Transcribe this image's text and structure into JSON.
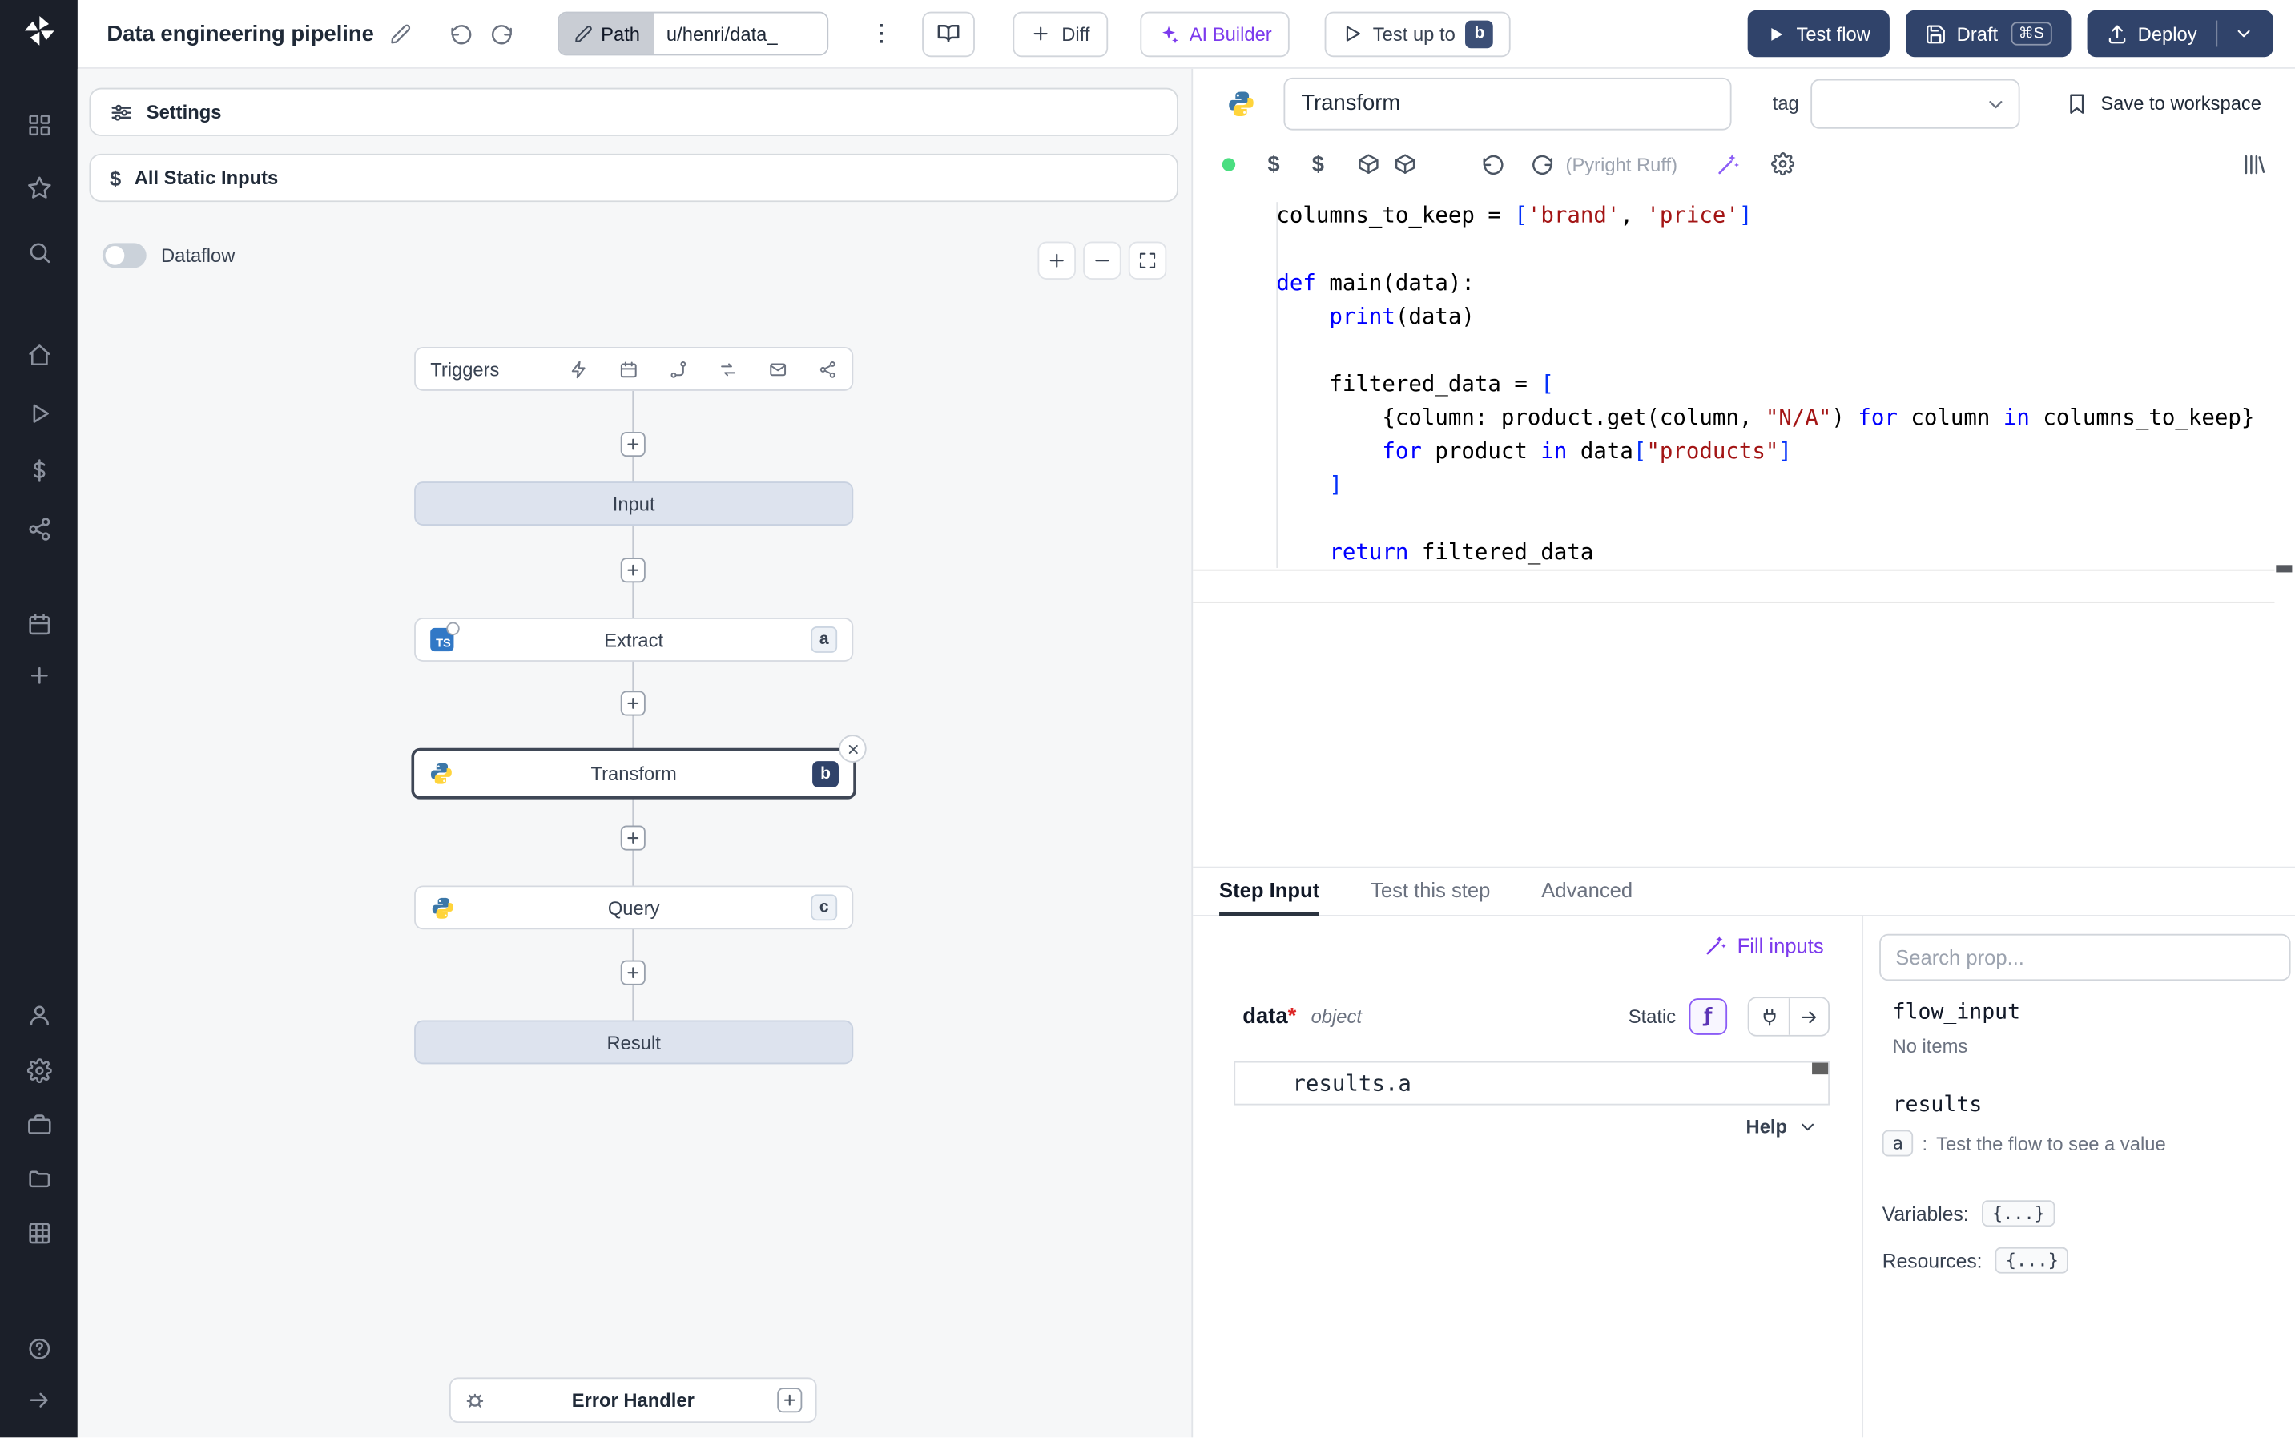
{
  "toolbar": {
    "title": "Data engineering pipeline",
    "path_button": "Path",
    "path_value": "u/henri/data_",
    "diff": "Diff",
    "ai_builder": "AI Builder",
    "test_up_to": "Test up to",
    "test_up_to_badge": "b",
    "test_flow": "Test flow",
    "draft": "Draft",
    "draft_shortcut": "⌘S",
    "deploy": "Deploy"
  },
  "flow": {
    "settings": "Settings",
    "all_static_inputs": "All Static Inputs",
    "dataflow": "Dataflow",
    "triggers_label": "Triggers",
    "ts_label": "TS",
    "nodes": [
      {
        "label": "Input"
      },
      {
        "label": "Extract",
        "badge": "a"
      },
      {
        "label": "Transform",
        "badge": "b"
      },
      {
        "label": "Query",
        "badge": "c"
      },
      {
        "label": "Result"
      }
    ],
    "error_handler": "Error Handler"
  },
  "editor": {
    "step_name": "Transform",
    "tag_label": "tag",
    "save_to_workspace": "Save to workspace",
    "lint": "(Pyright Ruff)",
    "code": {
      "language": "python",
      "lines": [
        [
          {
            "t": "columns_to_keep = "
          },
          {
            "t": "[",
            "c": "b"
          },
          {
            "t": "'brand'",
            "c": "s"
          },
          {
            "t": ", "
          },
          {
            "t": "'price'",
            "c": "s"
          },
          {
            "t": "]",
            "c": "b"
          }
        ],
        [],
        [
          {
            "t": "def",
            "c": "k"
          },
          {
            "t": " main(data):"
          }
        ],
        [
          {
            "t": "    "
          },
          {
            "t": "print",
            "c": "k"
          },
          {
            "t": "(data)"
          }
        ],
        [],
        [
          {
            "t": "    filtered_data = "
          },
          {
            "t": "[",
            "c": "b"
          }
        ],
        [
          {
            "t": "        {column: product.get(column, "
          },
          {
            "t": "\"N/A\"",
            "c": "s"
          },
          {
            "t": ") "
          },
          {
            "t": "for",
            "c": "k"
          },
          {
            "t": " column "
          },
          {
            "t": "in",
            "c": "k"
          },
          {
            "t": " columns_to_keep}"
          }
        ],
        [
          {
            "t": "        "
          },
          {
            "t": "for",
            "c": "k"
          },
          {
            "t": " product "
          },
          {
            "t": "in",
            "c": "k"
          },
          {
            "t": " data"
          },
          {
            "t": "[",
            "c": "b"
          },
          {
            "t": "\"products\"",
            "c": "s"
          },
          {
            "t": "]",
            "c": "b"
          }
        ],
        [
          {
            "t": "    "
          },
          {
            "t": "]",
            "c": "b"
          }
        ],
        [],
        [
          {
            "t": "    "
          },
          {
            "t": "return",
            "c": "k"
          },
          {
            "t": " filtered_data"
          }
        ]
      ]
    }
  },
  "step_panel": {
    "tabs": [
      "Step Input",
      "Test this step",
      "Advanced"
    ],
    "active_tab": "Step Input",
    "fill_inputs": "Fill inputs",
    "arg": {
      "name": "data",
      "required": "*",
      "type": "object"
    },
    "static_label": "Static",
    "expr": "results.a",
    "help": "Help"
  },
  "props": {
    "search_placeholder": "Search prop...",
    "flow_input": "flow_input",
    "no_items": "No items",
    "results": "results",
    "result_key": "a",
    "result_sep": ":",
    "result_hint": "Test the flow to see a value",
    "variables_label": "Variables:",
    "variables_value": "{...}",
    "resources_label": "Resources:",
    "resources_value": "{...}"
  },
  "colors": {
    "primary_navy": "#30436a",
    "accent_violet": "#7c3aed",
    "status_green": "#4ade80",
    "node_io_bg": "#dde3ee",
    "sidebar_bg": "#1b1f29"
  }
}
